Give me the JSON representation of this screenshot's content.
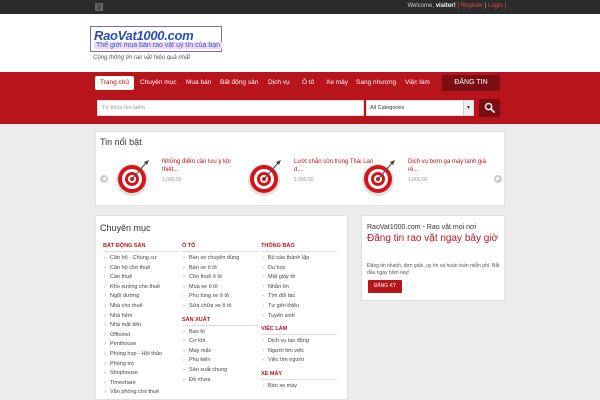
{
  "topbar": {
    "welcome_prefix": "Welcome,",
    "username": "visitor!",
    "register": "[ Register",
    "separator": "|",
    "login": "Login ]"
  },
  "header": {
    "logo_title": "RaoVat1000.com",
    "logo_subtitle": "Thế giới mua bán rao vặt uy tín của bạn",
    "slogan": "Cộng thông tin rao vặt hiệu quả nhất"
  },
  "nav": {
    "items": [
      "Trang chủ",
      "Chuyên mục",
      "Mua bán",
      "Bất động sản",
      "Dịch vụ",
      "Ô tô",
      "Xe máy",
      "Sang nhượng",
      "Việc làm"
    ],
    "post_button": "ĐĂNG TIN"
  },
  "search": {
    "placeholder": "Từ khóa tìm kiếm",
    "category_selected": "All Categories"
  },
  "featured": {
    "title": "Tin nổi bật",
    "items": [
      {
        "title": "Những điểm cần lưu ý khi thiết...",
        "price": "1,000.00"
      },
      {
        "title": "Lướt chắn còn trùng Thái Lan d...",
        "price": "1,000.00"
      },
      {
        "title": "Dịch vụ bơm ga máy lạnh giá rẻ...",
        "price": "1,000.00"
      }
    ]
  },
  "categories": {
    "title": "Chuyên mục",
    "bds": {
      "heading": "BẤT ĐỘNG SẢN",
      "items": [
        "Căn hộ - Chung cư",
        "Căn hộ cho thuê",
        "Cần thuê",
        "Kho xưởng cho thuê",
        "Ngôi dường",
        "Nhà cho thuê",
        "Nhà hẻm",
        "Nhà mặt tiền",
        "Officetel",
        "Penthouse",
        "Phòng họp - Hội thảo",
        "Phòng trọ",
        "Shophouse",
        "Timeshare",
        "Văn phòng cho thuê"
      ]
    },
    "oto": {
      "heading": "Ô TÔ",
      "items": [
        "Bán xe chuyên dùng",
        "Bán xe ô tô",
        "Cho thuê ô tô",
        "Mua xe ô tô",
        "Phụ tùng xe ô tô",
        "Sửa chữa xe ô tô"
      ]
    },
    "sx": {
      "heading": "SẢN XUẤT",
      "items": [
        "Bao bì",
        "Cơ khí",
        "May mặc",
        "Phụ kiện",
        "Sản xuất chung",
        "Đồ nhựa"
      ]
    },
    "tb": {
      "heading": "THÔNG BÁO",
      "items": [
        "Bố cáo thành lập",
        "Du học",
        "Mất giấy tờ",
        "Nhắn tìn",
        "Tìm đối tác",
        "Tư giới thiệu",
        "Tuyển sinh"
      ]
    },
    "vl": {
      "heading": "VIỆC LÀM",
      "items": [
        "Dịch vụ lao động",
        "Người tìm việc",
        "Việc tìm người"
      ]
    },
    "xm": {
      "heading": "XE MÁY",
      "items": [
        "Bán xe máy"
      ]
    }
  },
  "promo": {
    "heading": "RaoVat1000.com - Rao vặt mọi nơi",
    "title": "Đăng tin rao vặt ngay bây giờ",
    "desc": "Đăng tin nhanh, đơn giản, uy tín và hoàn toàn miễn phí. Bắt đầu ngay hôm nay!",
    "button": "ĐĂNG KÝ"
  },
  "colors": {
    "brand": "#b8141b",
    "brand_dark": "#7b0e12",
    "topbar": "#2b2b2b",
    "background": "#ececec"
  },
  "icons": {
    "rss": "rss-icon",
    "search": "search-icon",
    "target": "target-icon",
    "prev": "chevron-left-icon",
    "next": "chevron-right-icon"
  }
}
